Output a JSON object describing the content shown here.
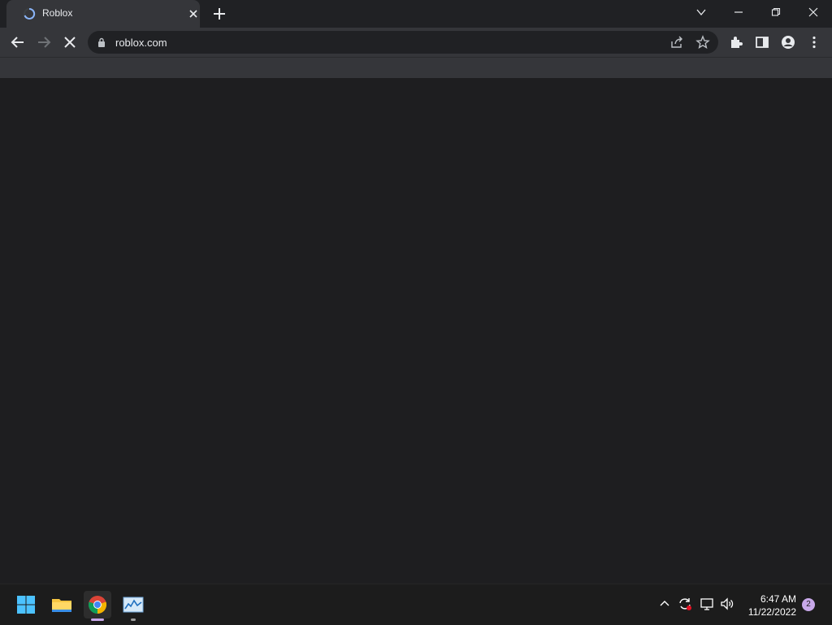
{
  "browser": {
    "tab": {
      "title": "Roblox",
      "loading": true
    },
    "address_bar": {
      "url": "roblox.com",
      "secure_icon": "lock-icon"
    },
    "nav": {
      "back": "back-arrow-icon",
      "forward": "forward-arrow-icon",
      "stop": "stop-x-icon"
    },
    "window_controls": [
      "tab-search-icon",
      "minimize-icon",
      "restore-icon",
      "close-icon"
    ],
    "toolbar_icons": [
      "share-icon",
      "star-icon",
      "extensions-icon",
      "side-panel-icon",
      "profile-icon",
      "menu-icon"
    ]
  },
  "taskbar": {
    "apps": [
      "windows-start-icon",
      "file-explorer-icon",
      "chrome-icon",
      "task-manager-icon"
    ],
    "tray_icons": [
      "chevron-up-icon",
      "sync-icon",
      "network-icon",
      "volume-icon"
    ],
    "clock": {
      "time": "6:47 AM",
      "date": "11/22/2022"
    },
    "notification_count": "2"
  },
  "colors": {
    "tab_bar": "#202124",
    "toolbar": "#35363a",
    "content": "#1e1e20",
    "taskbar": "#1c1c1c",
    "accent": "#8ab4f8",
    "notification_badge": "#c8a8e9"
  }
}
